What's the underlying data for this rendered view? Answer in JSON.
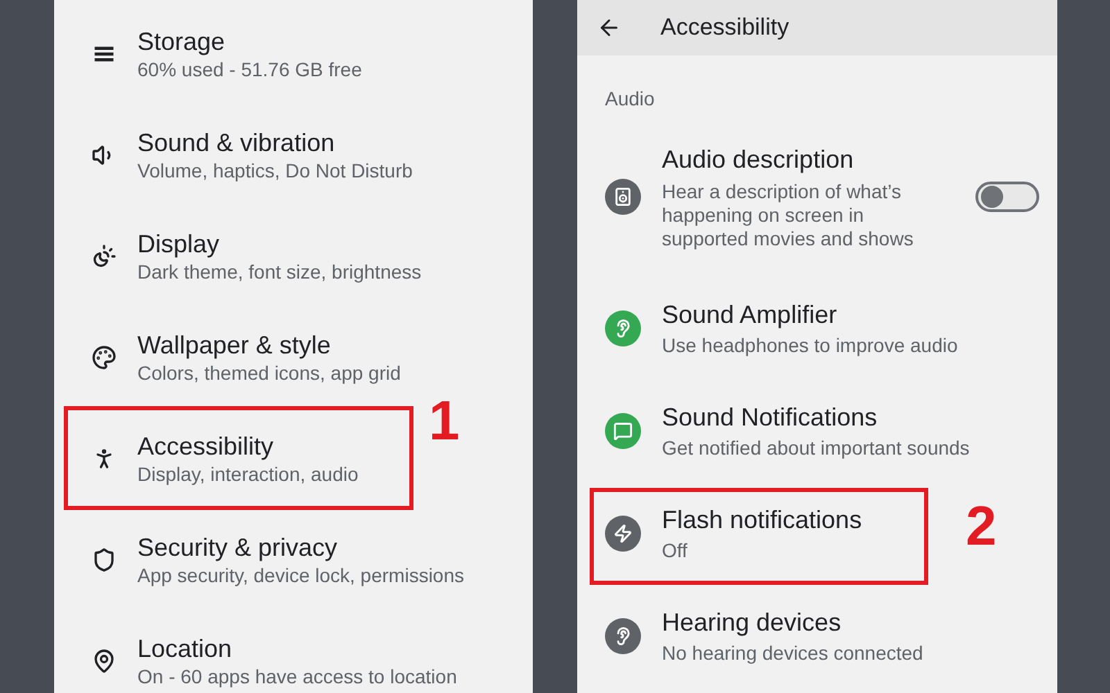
{
  "settings_list": {
    "items": [
      {
        "title": "Storage",
        "subtitle": "60% used - 51.76 GB free"
      },
      {
        "title": "Sound & vibration",
        "subtitle": "Volume, haptics, Do Not Disturb"
      },
      {
        "title": "Display",
        "subtitle": "Dark theme, font size, brightness"
      },
      {
        "title": "Wallpaper & style",
        "subtitle": "Colors, themed icons, app grid"
      },
      {
        "title": "Accessibility",
        "subtitle": "Display, interaction, audio",
        "annotation": "1"
      },
      {
        "title": "Security & privacy",
        "subtitle": "App security, device lock, permissions"
      },
      {
        "title": "Location",
        "subtitle": "On - 60 apps have access to location"
      }
    ]
  },
  "accessibility_screen": {
    "title": "Accessibility",
    "section": "Audio",
    "items": [
      {
        "title": "Audio description",
        "subtitle": "Hear a description of what’s happening on screen in supported movies and shows",
        "color": "#5f6368",
        "toggle": {
          "on": false
        }
      },
      {
        "title": "Sound Amplifier",
        "subtitle": "Use headphones to improve audio",
        "color": "#34a853"
      },
      {
        "title": "Sound Notifications",
        "subtitle": "Get notified about important sounds",
        "color": "#34a853"
      },
      {
        "title": "Flash notifications",
        "subtitle": "Off",
        "color": "#5f6368",
        "annotation": "2"
      },
      {
        "title": "Hearing devices",
        "subtitle": "No hearing devices connected",
        "color": "#5f6368"
      }
    ]
  }
}
